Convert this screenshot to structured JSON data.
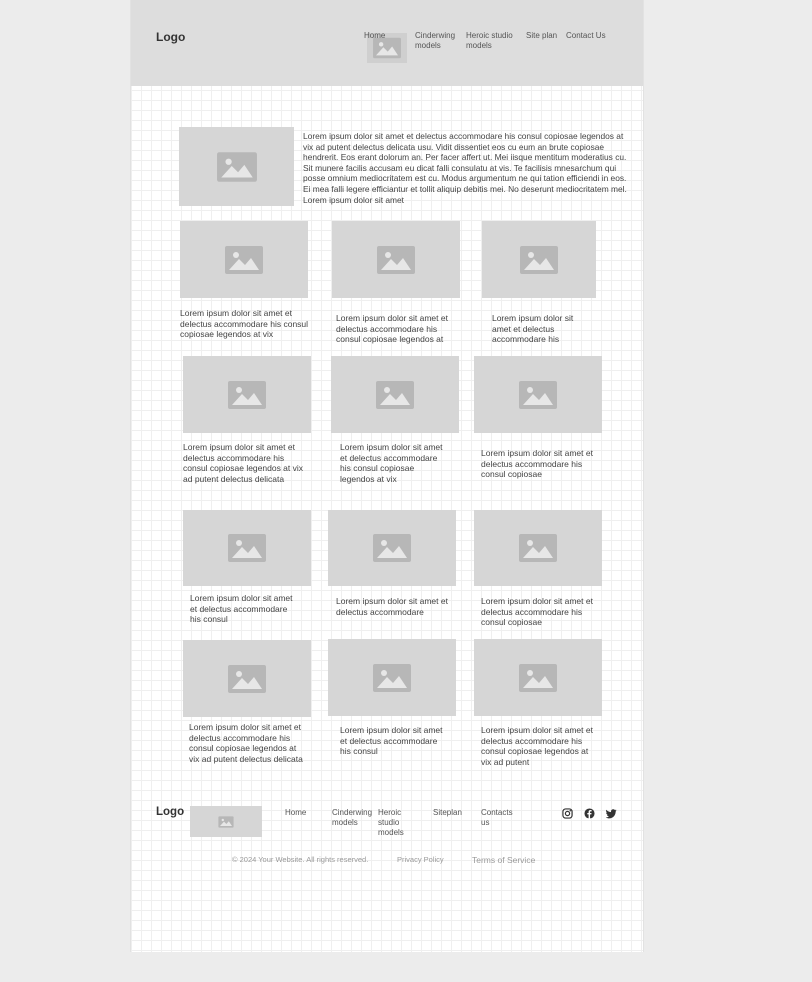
{
  "header": {
    "logo": "Logo",
    "nav": [
      "Home",
      "Cinderwing models",
      "Heroic studio models",
      "Site plan",
      "Contact Us"
    ]
  },
  "intro": {
    "text": "Lorem ipsum dolor sit amet et delectus accommodare his consul copiosae legendos at vix ad putent delectus delicata usu. Vidit dissentiet eos cu eum an brute copiosae hendrerit. Eos erant dolorum an. Per facer affert ut. Mei iisque mentitum moderatius cu. Sit munere facilis accusam eu dicat falli consulatu at vis. Te facilisis mnesarchum qui posse omnium mediocritatem est cu. Modus argumentum ne qui tation efficiendi in eos. Ei mea falli legere efficiantur et tollit aliquip debitis mei. No deserunt mediocritatem mel. Lorem ipsum dolor sit amet"
  },
  "cards": [
    "Lorem ipsum dolor sit amet et delectus accommodare his consul copiosae legendos at vix",
    "Lorem ipsum dolor sit amet et delectus accommodare his consul copiosae legendos at",
    "Lorem ipsum dolor sit amet et delectus accommodare his",
    "Lorem ipsum dolor sit amet et delectus accommodare his consul copiosae legendos at vix ad putent delectus delicata",
    "Lorem ipsum dolor sit amet et delectus accommodare his consul copiosae legendos at vix",
    "Lorem ipsum dolor sit amet et delectus accommodare his consul copiosae",
    "Lorem ipsum dolor sit amet et delectus accommodare his consul",
    "Lorem ipsum dolor sit amet et delectus accommodare",
    "Lorem ipsum dolor sit amet et delectus accommodare his consul copiosae",
    "Lorem ipsum dolor sit amet et delectus accommodare his consul copiosae legendos at vix ad putent delectus delicata",
    "Lorem ipsum dolor sit amet et delectus accommodare his consul",
    "Lorem ipsum dolor sit amet et delectus accommodare his consul copiosae legendos at vix ad putent"
  ],
  "footer": {
    "logo": "Logo",
    "nav": [
      "Home",
      "Cinderwing models",
      "Heroic studio models",
      "Siteplan",
      "Contacts us"
    ],
    "social_icons": [
      "instagram-icon",
      "facebook-icon",
      "twitter-icon"
    ],
    "copyright": "© 2024 Your Website. All rights reserved.",
    "privacy": "Privacy Policy",
    "terms": "Terms of Service"
  }
}
